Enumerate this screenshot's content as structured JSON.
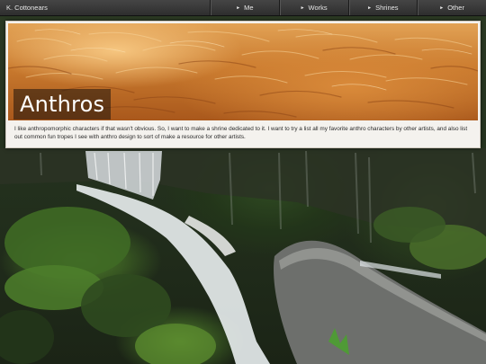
{
  "nav": {
    "brand": "K. Cottonears",
    "items": [
      {
        "label": "Me"
      },
      {
        "label": "Works"
      },
      {
        "label": "Shrines"
      },
      {
        "label": "Other"
      }
    ],
    "arrow_glyph": "►"
  },
  "card": {
    "title": "Anthros",
    "description": "I like anthropomorphic characters if that wasn't obvious. So, I want to make a shrine dedicated to it. I want to try a list all my favorite anthro characters by other artists, and also list out common fun tropes I see with anthro design to sort of make a resource for other artists."
  },
  "colors": {
    "navbar": "#3a3a3a",
    "card_background": "#f4f2ee",
    "title_text": "#ffffff",
    "fur_orange": "#d98a3a"
  }
}
